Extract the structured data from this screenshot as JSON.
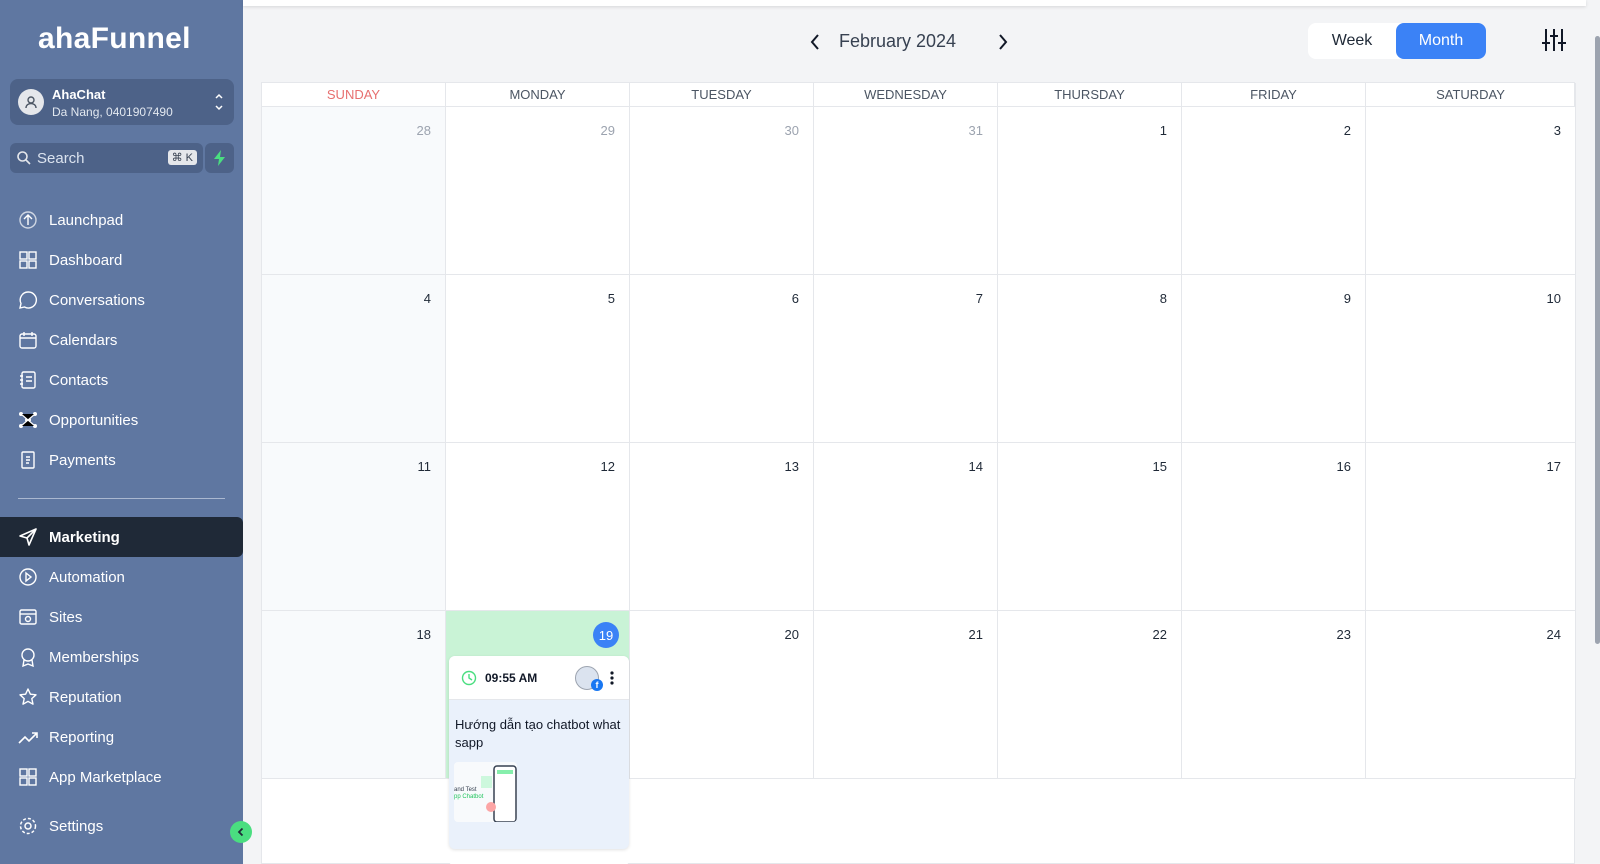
{
  "sidebar": {
    "logo": "ahaFunnel",
    "account": {
      "name": "AhaChat",
      "address": "Da Nang, 0401907490"
    },
    "search": {
      "placeholder": "Search",
      "shortcut": "⌘ K"
    },
    "items": [
      {
        "label": "Launchpad",
        "icon": "launchpad-icon"
      },
      {
        "label": "Dashboard",
        "icon": "dashboard-icon"
      },
      {
        "label": "Conversations",
        "icon": "chat-icon"
      },
      {
        "label": "Calendars",
        "icon": "calendar-icon"
      },
      {
        "label": "Contacts",
        "icon": "contacts-icon"
      },
      {
        "label": "Opportunities",
        "icon": "opportunities-icon"
      },
      {
        "label": "Payments",
        "icon": "payments-icon"
      }
    ],
    "items2": [
      {
        "label": "Marketing",
        "icon": "send-icon",
        "active": true
      },
      {
        "label": "Automation",
        "icon": "automation-icon"
      },
      {
        "label": "Sites",
        "icon": "sites-icon"
      },
      {
        "label": "Memberships",
        "icon": "memberships-icon"
      },
      {
        "label": "Reputation",
        "icon": "star-icon"
      },
      {
        "label": "Reporting",
        "icon": "trend-icon"
      },
      {
        "label": "App Marketplace",
        "icon": "apps-icon"
      }
    ],
    "settings": {
      "label": "Settings",
      "icon": "gear-icon"
    }
  },
  "header": {
    "month_title": "February 2024",
    "view_week": "Week",
    "view_month": "Month"
  },
  "calendar": {
    "weekdays": [
      "SUNDAY",
      "MONDAY",
      "TUESDAY",
      "WEDNESDAY",
      "THURSDAY",
      "FRIDAY",
      "SATURDAY"
    ],
    "weeks": [
      [
        "28",
        "29",
        "30",
        "31",
        "1",
        "2",
        "3"
      ],
      [
        "4",
        "5",
        "6",
        "7",
        "8",
        "9",
        "10"
      ],
      [
        "11",
        "12",
        "13",
        "14",
        "15",
        "16",
        "17"
      ],
      [
        "18",
        "19",
        "20",
        "21",
        "22",
        "23",
        "24"
      ]
    ],
    "today": "19",
    "event": {
      "time": "09:55 AM",
      "title": "Hướng dẫn tạo chatbot whatsapp",
      "thumb_line1": "and Test",
      "thumb_line2": "pp Chatbot"
    }
  },
  "colors": {
    "sidebar": "#5f77a1",
    "accent": "#3b82f6",
    "today": "#c9f3d6",
    "sunday": "#e76f6f"
  }
}
